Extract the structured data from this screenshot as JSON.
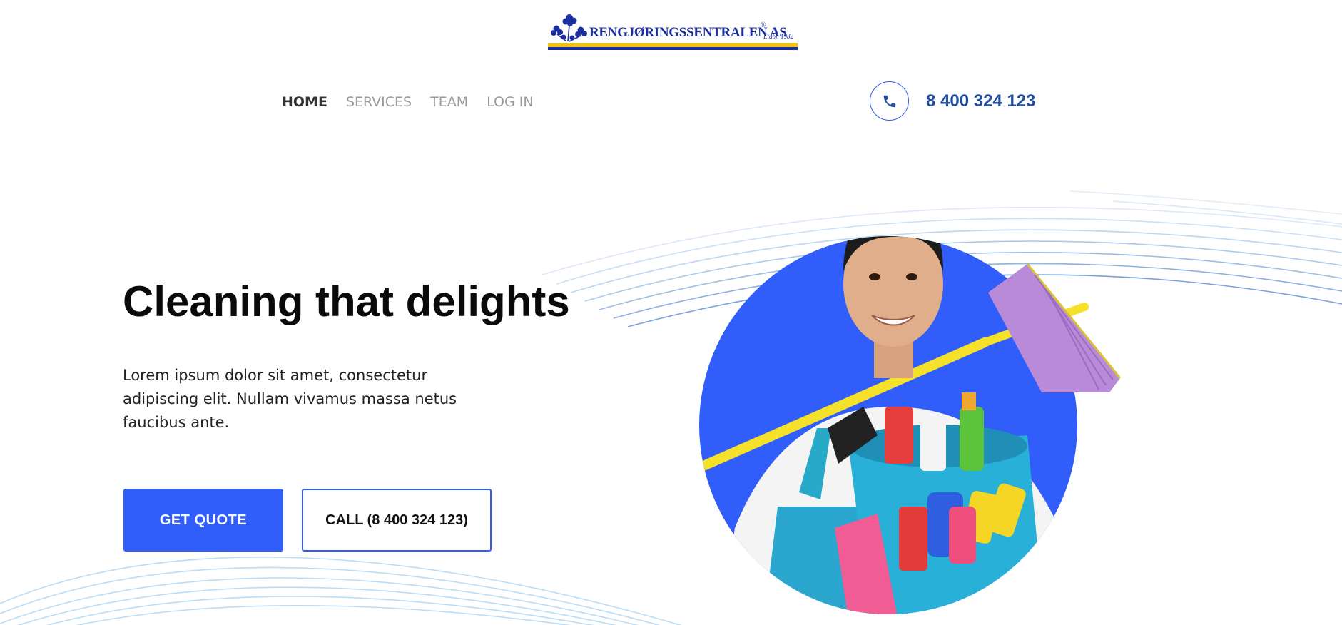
{
  "logo": {
    "text": "RENGJØRINGSSENTRALEN AS",
    "registered": "®",
    "established": "Etabl. 1982"
  },
  "nav": {
    "items": [
      {
        "label": "HOME",
        "active": true
      },
      {
        "label": "SERVICES",
        "active": false
      },
      {
        "label": "TEAM",
        "active": false
      },
      {
        "label": "LOG IN",
        "active": false
      }
    ]
  },
  "contact": {
    "icon": "phone-icon",
    "phone": "8 400 324 123"
  },
  "hero": {
    "title": "Cleaning that delights",
    "description": "Lorem ipsum dolor sit amet, consectetur adipiscing elit. Nullam vivamus massa netus faucibus ante.",
    "primary_button": "GET QUOTE",
    "secondary_button": "CALL (8 400 324 123)",
    "image": "cleaner-with-broom-and-bucket"
  },
  "colors": {
    "accent": "#315efb",
    "phone_text": "#1f4ea3",
    "logo_blue": "#1b2fa0",
    "logo_yellow": "#f1c40f",
    "wave_lines": "#9cc4ef"
  }
}
